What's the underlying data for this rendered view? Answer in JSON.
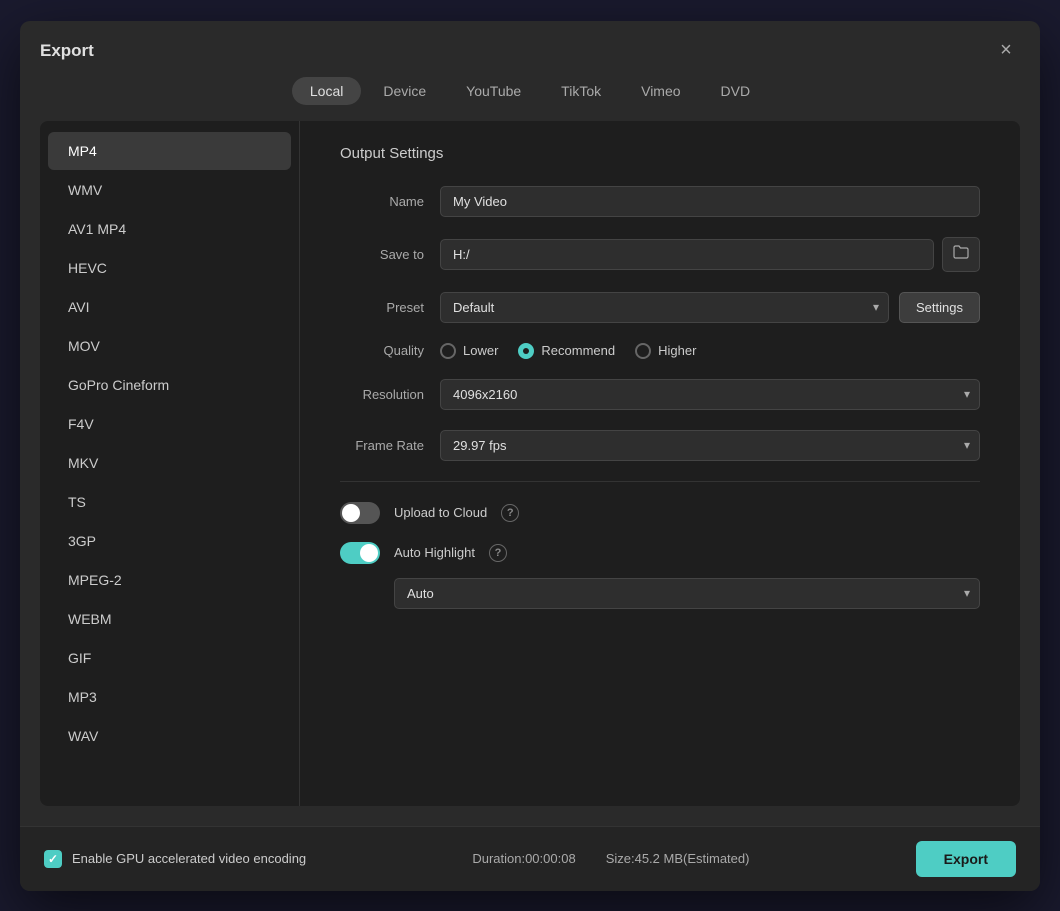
{
  "dialog": {
    "title": "Export",
    "close_label": "×"
  },
  "tabs": [
    {
      "id": "local",
      "label": "Local",
      "active": true
    },
    {
      "id": "device",
      "label": "Device",
      "active": false
    },
    {
      "id": "youtube",
      "label": "YouTube",
      "active": false
    },
    {
      "id": "tiktok",
      "label": "TikTok",
      "active": false
    },
    {
      "id": "vimeo",
      "label": "Vimeo",
      "active": false
    },
    {
      "id": "dvd",
      "label": "DVD",
      "active": false
    }
  ],
  "formats": [
    {
      "id": "mp4",
      "label": "MP4",
      "active": true
    },
    {
      "id": "wmv",
      "label": "WMV",
      "active": false
    },
    {
      "id": "av1mp4",
      "label": "AV1 MP4",
      "active": false
    },
    {
      "id": "hevc",
      "label": "HEVC",
      "active": false
    },
    {
      "id": "avi",
      "label": "AVI",
      "active": false
    },
    {
      "id": "mov",
      "label": "MOV",
      "active": false
    },
    {
      "id": "gopro",
      "label": "GoPro Cineform",
      "active": false
    },
    {
      "id": "f4v",
      "label": "F4V",
      "active": false
    },
    {
      "id": "mkv",
      "label": "MKV",
      "active": false
    },
    {
      "id": "ts",
      "label": "TS",
      "active": false
    },
    {
      "id": "3gp",
      "label": "3GP",
      "active": false
    },
    {
      "id": "mpeg2",
      "label": "MPEG-2",
      "active": false
    },
    {
      "id": "webm",
      "label": "WEBM",
      "active": false
    },
    {
      "id": "gif",
      "label": "GIF",
      "active": false
    },
    {
      "id": "mp3",
      "label": "MP3",
      "active": false
    },
    {
      "id": "wav",
      "label": "WAV",
      "active": false
    }
  ],
  "settings": {
    "section_title": "Output Settings",
    "name_label": "Name",
    "name_value": "My Video",
    "save_to_label": "Save to",
    "save_to_value": "H:/",
    "preset_label": "Preset",
    "preset_value": "Default",
    "settings_btn_label": "Settings",
    "quality_label": "Quality",
    "quality_options": [
      {
        "id": "lower",
        "label": "Lower",
        "checked": false
      },
      {
        "id": "recommend",
        "label": "Recommend",
        "checked": true
      },
      {
        "id": "higher",
        "label": "Higher",
        "checked": false
      }
    ],
    "resolution_label": "Resolution",
    "resolution_value": "4096x2160",
    "frame_rate_label": "Frame Rate",
    "frame_rate_value": "29.97 fps",
    "upload_cloud_label": "Upload to Cloud",
    "upload_cloud_on": false,
    "auto_highlight_label": "Auto Highlight",
    "auto_highlight_on": true,
    "auto_highlight_select": "Auto"
  },
  "footer": {
    "gpu_label": "Enable GPU accelerated video encoding",
    "gpu_checked": true,
    "duration_label": "Duration:00:00:08",
    "size_label": "Size:45.2 MB(Estimated)",
    "export_label": "Export"
  }
}
